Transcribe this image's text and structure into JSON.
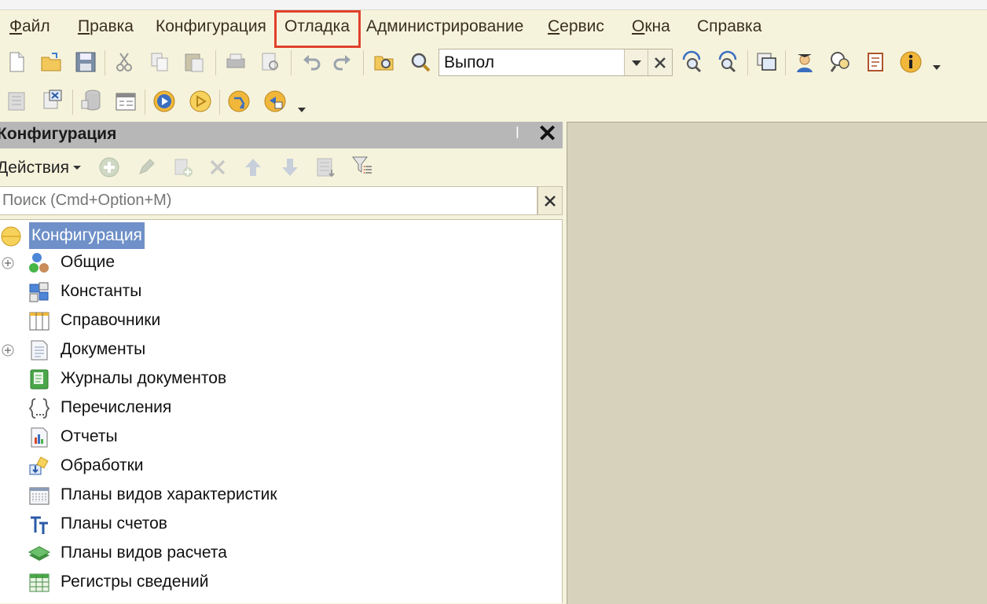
{
  "menu": {
    "items": [
      {
        "label": "Файл",
        "accel": "Ф",
        "rest": "айл"
      },
      {
        "label": "Правка",
        "accel": "П",
        "rest": "равка"
      },
      {
        "label": "Конфигурация",
        "accel": "",
        "rest": "Конфигурация"
      },
      {
        "label": "Отладка",
        "accel": "",
        "rest": "Отладка"
      },
      {
        "label": "Администрирование",
        "accel": "",
        "rest": "Администрирование"
      },
      {
        "label": "Сервис",
        "accel": "С",
        "rest": "ервис"
      },
      {
        "label": "Окна",
        "accel": "О",
        "rest": "кна"
      },
      {
        "label": "Справка",
        "accel": "",
        "rest": "Справка"
      }
    ]
  },
  "toolbar": {
    "search_value": "Выпол"
  },
  "config_panel": {
    "title": "Конфигурация",
    "actions_label": "Действия",
    "search_placeholder": "Поиск (Cmd+Option+M)"
  },
  "tree": {
    "root": "Конфигурация",
    "items": [
      {
        "label": "Общие",
        "icon": "common-icon",
        "expandable": true
      },
      {
        "label": "Константы",
        "icon": "constants-icon",
        "expandable": false
      },
      {
        "label": "Справочники",
        "icon": "catalogs-icon",
        "expandable": false
      },
      {
        "label": "Документы",
        "icon": "documents-icon",
        "expandable": true
      },
      {
        "label": "Журналы документов",
        "icon": "document-journals-icon",
        "expandable": false
      },
      {
        "label": "Перечисления",
        "icon": "enums-icon",
        "expandable": false
      },
      {
        "label": "Отчеты",
        "icon": "reports-icon",
        "expandable": false
      },
      {
        "label": "Обработки",
        "icon": "data-processors-icon",
        "expandable": false
      },
      {
        "label": "Планы видов характеристик",
        "icon": "chart-of-characteristic-types-icon",
        "expandable": false
      },
      {
        "label": "Планы счетов",
        "icon": "chart-of-accounts-icon",
        "expandable": false
      },
      {
        "label": "Планы видов расчета",
        "icon": "chart-of-calculation-types-icon",
        "expandable": false
      },
      {
        "label": "Регистры сведений",
        "icon": "information-registers-icon",
        "expandable": false
      }
    ]
  },
  "colors": {
    "highlight_border": "#e0412b",
    "selection": "#6f90c8",
    "background": "#f6f3dc"
  }
}
